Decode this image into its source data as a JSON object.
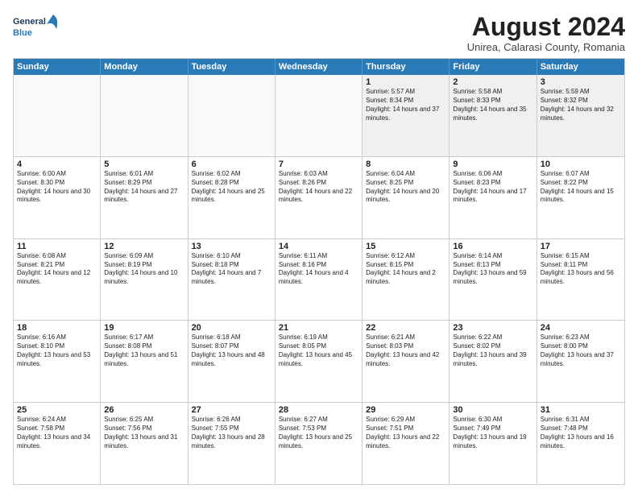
{
  "header": {
    "logo_line1": "General",
    "logo_line2": "Blue",
    "month_year": "August 2024",
    "location": "Unirea, Calarasi County, Romania"
  },
  "days_of_week": [
    "Sunday",
    "Monday",
    "Tuesday",
    "Wednesday",
    "Thursday",
    "Friday",
    "Saturday"
  ],
  "weeks": [
    [
      {
        "day": "",
        "sunrise": "",
        "sunset": "",
        "daylight": "",
        "empty": true
      },
      {
        "day": "",
        "sunrise": "",
        "sunset": "",
        "daylight": "",
        "empty": true
      },
      {
        "day": "",
        "sunrise": "",
        "sunset": "",
        "daylight": "",
        "empty": true
      },
      {
        "day": "",
        "sunrise": "",
        "sunset": "",
        "daylight": "",
        "empty": true
      },
      {
        "day": "1",
        "sunrise": "Sunrise: 5:57 AM",
        "sunset": "Sunset: 8:34 PM",
        "daylight": "Daylight: 14 hours and 37 minutes.",
        "empty": false
      },
      {
        "day": "2",
        "sunrise": "Sunrise: 5:58 AM",
        "sunset": "Sunset: 8:33 PM",
        "daylight": "Daylight: 14 hours and 35 minutes.",
        "empty": false
      },
      {
        "day": "3",
        "sunrise": "Sunrise: 5:59 AM",
        "sunset": "Sunset: 8:32 PM",
        "daylight": "Daylight: 14 hours and 32 minutes.",
        "empty": false
      }
    ],
    [
      {
        "day": "4",
        "sunrise": "Sunrise: 6:00 AM",
        "sunset": "Sunset: 8:30 PM",
        "daylight": "Daylight: 14 hours and 30 minutes.",
        "empty": false
      },
      {
        "day": "5",
        "sunrise": "Sunrise: 6:01 AM",
        "sunset": "Sunset: 8:29 PM",
        "daylight": "Daylight: 14 hours and 27 minutes.",
        "empty": false
      },
      {
        "day": "6",
        "sunrise": "Sunrise: 6:02 AM",
        "sunset": "Sunset: 8:28 PM",
        "daylight": "Daylight: 14 hours and 25 minutes.",
        "empty": false
      },
      {
        "day": "7",
        "sunrise": "Sunrise: 6:03 AM",
        "sunset": "Sunset: 8:26 PM",
        "daylight": "Daylight: 14 hours and 22 minutes.",
        "empty": false
      },
      {
        "day": "8",
        "sunrise": "Sunrise: 6:04 AM",
        "sunset": "Sunset: 8:25 PM",
        "daylight": "Daylight: 14 hours and 20 minutes.",
        "empty": false
      },
      {
        "day": "9",
        "sunrise": "Sunrise: 6:06 AM",
        "sunset": "Sunset: 8:23 PM",
        "daylight": "Daylight: 14 hours and 17 minutes.",
        "empty": false
      },
      {
        "day": "10",
        "sunrise": "Sunrise: 6:07 AM",
        "sunset": "Sunset: 8:22 PM",
        "daylight": "Daylight: 14 hours and 15 minutes.",
        "empty": false
      }
    ],
    [
      {
        "day": "11",
        "sunrise": "Sunrise: 6:08 AM",
        "sunset": "Sunset: 8:21 PM",
        "daylight": "Daylight: 14 hours and 12 minutes.",
        "empty": false
      },
      {
        "day": "12",
        "sunrise": "Sunrise: 6:09 AM",
        "sunset": "Sunset: 8:19 PM",
        "daylight": "Daylight: 14 hours and 10 minutes.",
        "empty": false
      },
      {
        "day": "13",
        "sunrise": "Sunrise: 6:10 AM",
        "sunset": "Sunset: 8:18 PM",
        "daylight": "Daylight: 14 hours and 7 minutes.",
        "empty": false
      },
      {
        "day": "14",
        "sunrise": "Sunrise: 6:11 AM",
        "sunset": "Sunset: 8:16 PM",
        "daylight": "Daylight: 14 hours and 4 minutes.",
        "empty": false
      },
      {
        "day": "15",
        "sunrise": "Sunrise: 6:12 AM",
        "sunset": "Sunset: 8:15 PM",
        "daylight": "Daylight: 14 hours and 2 minutes.",
        "empty": false
      },
      {
        "day": "16",
        "sunrise": "Sunrise: 6:14 AM",
        "sunset": "Sunset: 8:13 PM",
        "daylight": "Daylight: 13 hours and 59 minutes.",
        "empty": false
      },
      {
        "day": "17",
        "sunrise": "Sunrise: 6:15 AM",
        "sunset": "Sunset: 8:11 PM",
        "daylight": "Daylight: 13 hours and 56 minutes.",
        "empty": false
      }
    ],
    [
      {
        "day": "18",
        "sunrise": "Sunrise: 6:16 AM",
        "sunset": "Sunset: 8:10 PM",
        "daylight": "Daylight: 13 hours and 53 minutes.",
        "empty": false
      },
      {
        "day": "19",
        "sunrise": "Sunrise: 6:17 AM",
        "sunset": "Sunset: 8:08 PM",
        "daylight": "Daylight: 13 hours and 51 minutes.",
        "empty": false
      },
      {
        "day": "20",
        "sunrise": "Sunrise: 6:18 AM",
        "sunset": "Sunset: 8:07 PM",
        "daylight": "Daylight: 13 hours and 48 minutes.",
        "empty": false
      },
      {
        "day": "21",
        "sunrise": "Sunrise: 6:19 AM",
        "sunset": "Sunset: 8:05 PM",
        "daylight": "Daylight: 13 hours and 45 minutes.",
        "empty": false
      },
      {
        "day": "22",
        "sunrise": "Sunrise: 6:21 AM",
        "sunset": "Sunset: 8:03 PM",
        "daylight": "Daylight: 13 hours and 42 minutes.",
        "empty": false
      },
      {
        "day": "23",
        "sunrise": "Sunrise: 6:22 AM",
        "sunset": "Sunset: 8:02 PM",
        "daylight": "Daylight: 13 hours and 39 minutes.",
        "empty": false
      },
      {
        "day": "24",
        "sunrise": "Sunrise: 6:23 AM",
        "sunset": "Sunset: 8:00 PM",
        "daylight": "Daylight: 13 hours and 37 minutes.",
        "empty": false
      }
    ],
    [
      {
        "day": "25",
        "sunrise": "Sunrise: 6:24 AM",
        "sunset": "Sunset: 7:58 PM",
        "daylight": "Daylight: 13 hours and 34 minutes.",
        "empty": false
      },
      {
        "day": "26",
        "sunrise": "Sunrise: 6:25 AM",
        "sunset": "Sunset: 7:56 PM",
        "daylight": "Daylight: 13 hours and 31 minutes.",
        "empty": false
      },
      {
        "day": "27",
        "sunrise": "Sunrise: 6:26 AM",
        "sunset": "Sunset: 7:55 PM",
        "daylight": "Daylight: 13 hours and 28 minutes.",
        "empty": false
      },
      {
        "day": "28",
        "sunrise": "Sunrise: 6:27 AM",
        "sunset": "Sunset: 7:53 PM",
        "daylight": "Daylight: 13 hours and 25 minutes.",
        "empty": false
      },
      {
        "day": "29",
        "sunrise": "Sunrise: 6:29 AM",
        "sunset": "Sunset: 7:51 PM",
        "daylight": "Daylight: 13 hours and 22 minutes.",
        "empty": false
      },
      {
        "day": "30",
        "sunrise": "Sunrise: 6:30 AM",
        "sunset": "Sunset: 7:49 PM",
        "daylight": "Daylight: 13 hours and 19 minutes.",
        "empty": false
      },
      {
        "day": "31",
        "sunrise": "Sunrise: 6:31 AM",
        "sunset": "Sunset: 7:48 PM",
        "daylight": "Daylight: 13 hours and 16 minutes.",
        "empty": false
      }
    ]
  ]
}
